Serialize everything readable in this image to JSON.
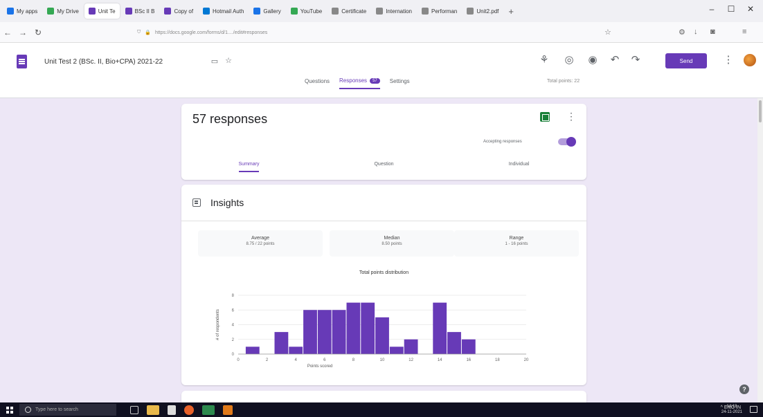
{
  "browser": {
    "tabs": [
      {
        "label": "My apps",
        "color": "#1a73e8"
      },
      {
        "label": "My Drive",
        "color": "#34a853"
      },
      {
        "label": "Unit Te",
        "color": "#673ab7",
        "active": true
      },
      {
        "label": "BSc II B",
        "color": "#673ab7"
      },
      {
        "label": "Copy of",
        "color": "#673ab7"
      },
      {
        "label": "Hotmail Auth",
        "color": "#0078d4"
      },
      {
        "label": "Gallery",
        "color": "#1a73e8"
      },
      {
        "label": "YouTube",
        "color": "#34a853"
      },
      {
        "label": "Certificate",
        "color": "#888888"
      },
      {
        "label": "Internation",
        "color": "#888888"
      },
      {
        "label": "Performan",
        "color": "#888888"
      },
      {
        "label": "Unit2.pdf",
        "color": "#888888"
      }
    ],
    "url": "https://docs.google.com/forms/d/1..../edit#responses"
  },
  "header": {
    "form_title": "Unit Test 2 (BSc. II, Bio+CPA) 2021-22",
    "send_label": "Send",
    "tabs": [
      {
        "label": "Questions"
      },
      {
        "label": "Responses",
        "badge": "57",
        "active": true
      },
      {
        "label": "Settings"
      }
    ],
    "total_points": "Total points: 22"
  },
  "summary": {
    "heading": "57 responses",
    "accepting_label": "Accepting responses",
    "sub_tabs": [
      "Summary",
      "Question",
      "Individual"
    ]
  },
  "insights": {
    "heading": "Insights",
    "stats": [
      {
        "label": "Average",
        "value": "8.75 / 22 points"
      },
      {
        "label": "Median",
        "value": "8.50 points"
      },
      {
        "label": "Range",
        "value": "1 - 16 points"
      }
    ]
  },
  "chart_data": {
    "type": "bar",
    "title": "Total points distribution",
    "xlabel": "Points scored",
    "ylabel": "# of respondents",
    "x": [
      1,
      3,
      4,
      5,
      6,
      7,
      8,
      9,
      10,
      11,
      12,
      14,
      15,
      16
    ],
    "values": [
      1,
      3,
      1,
      6,
      6,
      6,
      7,
      7,
      5,
      1,
      2,
      7,
      3,
      2
    ],
    "xticks": [
      0,
      2,
      4,
      6,
      8,
      10,
      12,
      14,
      16,
      18,
      20
    ],
    "yticks": [
      0,
      2,
      4,
      6,
      8
    ],
    "xlim": [
      0,
      20
    ],
    "ylim": [
      0,
      8
    ],
    "bar_color": "#673ab7",
    "grid": true
  },
  "taskbar": {
    "search_placeholder": "Type here to search",
    "tray": "^  ENG  IN",
    "time": "14:18",
    "date": "24-11-2021"
  },
  "colors": {
    "accent": "#673ab7",
    "sheets": "#188038"
  }
}
